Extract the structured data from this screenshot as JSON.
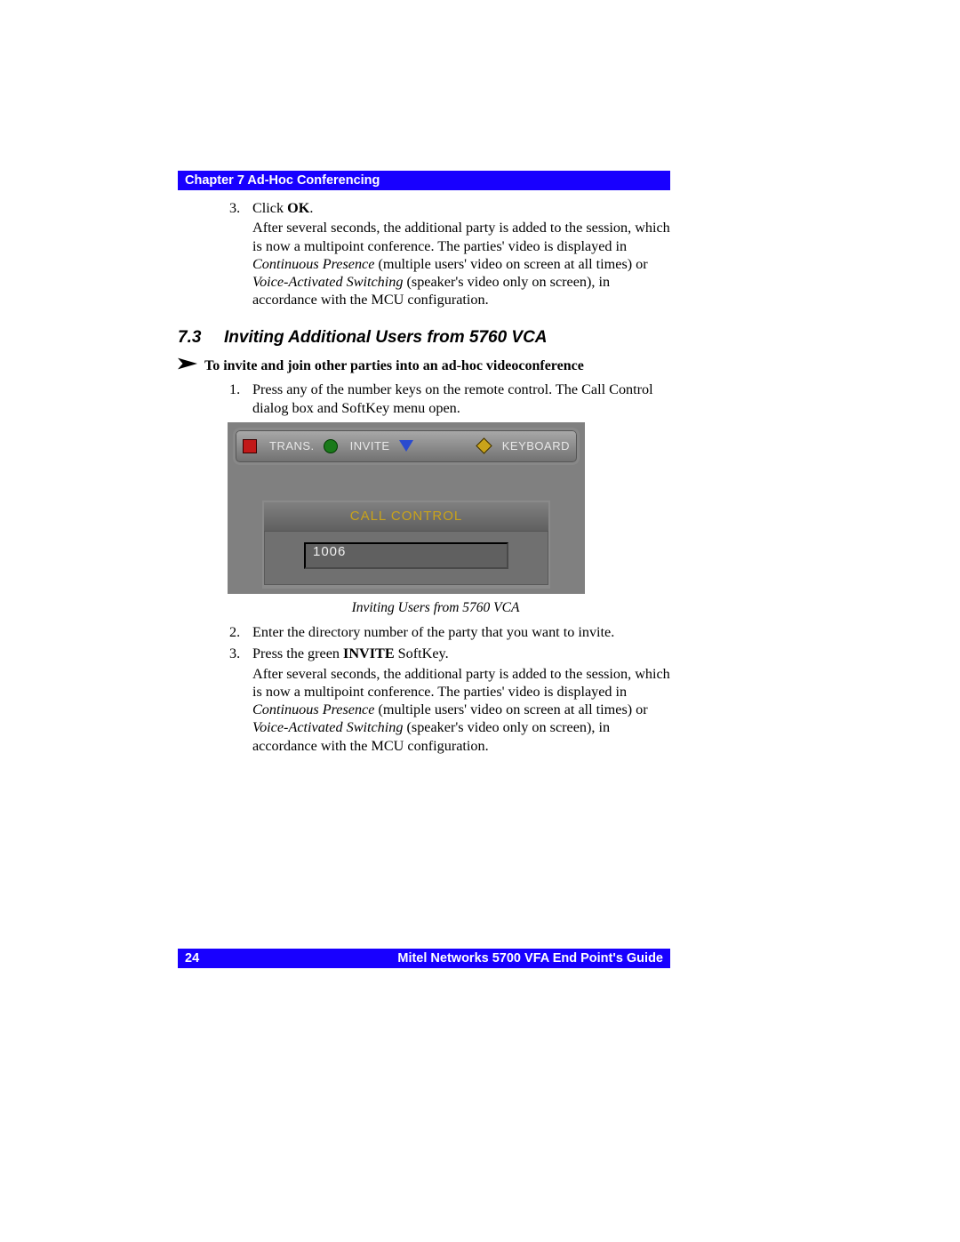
{
  "header": {
    "chapter": "Chapter 7 Ad-Hoc Conferencing"
  },
  "step3": {
    "num": "3.",
    "line1_a": "Click ",
    "line1_b": "OK",
    "line1_c": ".",
    "para_a": "After several seconds, the additional party is added to the session, which is now a multipoint conference. The parties' video is displayed in ",
    "para_i1": "Continuous Presence",
    "para_b": " (multiple users' video on screen at all times) or ",
    "para_i2": "Voice-Activated Switching",
    "para_c": " (speaker's video only on screen), in accordance with the MCU configuration."
  },
  "section": {
    "num": "7.3",
    "title": "Inviting Additional Users from 5760 VCA"
  },
  "subheading": "To invite and join other parties into an ad-hoc videoconference",
  "step1b": {
    "num": "1.",
    "text": "Press any of the number keys on the remote control. The Call Control dialog box and SoftKey menu open."
  },
  "figure": {
    "menu": {
      "trans": "TRANS.",
      "invite": "INVITE",
      "keyboard": "KEYBOARD"
    },
    "panel": {
      "title": "CALL CONTROL",
      "value": "1006"
    },
    "caption": "Inviting Users from 5760 VCA"
  },
  "step2": {
    "num": "2.",
    "text": "Enter the directory number of the party that you want to invite."
  },
  "step3b": {
    "num": "3.",
    "line_a": "Press the green ",
    "line_b": "INVITE",
    "line_c": " SoftKey.",
    "para_a": "After several seconds, the additional party is added to the session, which is now a multipoint conference. The parties' video is displayed in ",
    "para_i1": "Continuous Presence",
    "para_b": " (multiple users' video on screen at all times) or ",
    "para_i2": "Voice-Activated Switching",
    "para_c": " (speaker's video only on screen), in accordance with the MCU configuration."
  },
  "footer": {
    "page": "24",
    "guide": "Mitel Networks 5700 VFA End Point's Guide"
  }
}
